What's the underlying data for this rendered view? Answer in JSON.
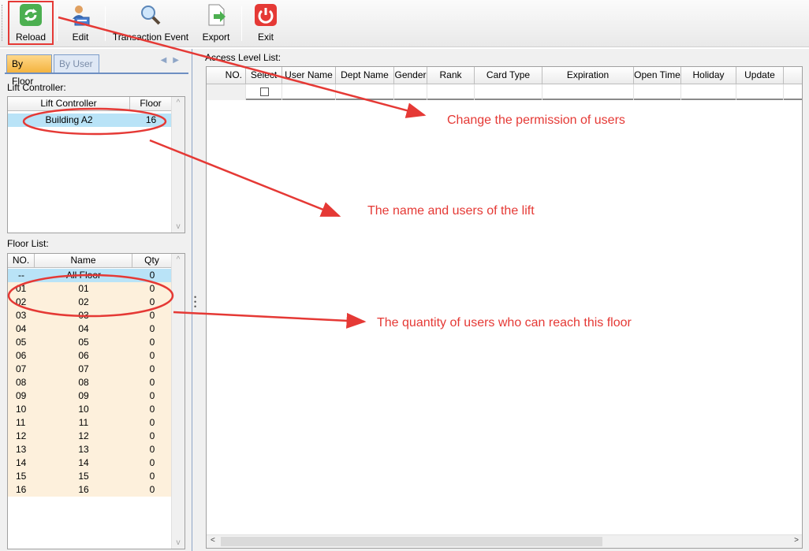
{
  "toolbar": {
    "reload": "Reload",
    "edit": "Edit",
    "transaction_event": "Transaction Event",
    "export": "Export",
    "exit": "Exit"
  },
  "left": {
    "tabs": [
      "By Floor",
      "By User"
    ],
    "lift_controller_label": "Lift Controller:",
    "lift_columns": [
      "Lift Controller",
      "Floor"
    ],
    "lift_rows": [
      {
        "name": "Building A2",
        "floor": "16"
      }
    ],
    "floor_list_label": "Floor List:",
    "floor_columns": [
      "NO.",
      "Name",
      "Qty"
    ],
    "floor_rows": [
      {
        "no": "--",
        "name": "All Floor",
        "qty": "0"
      },
      {
        "no": "01",
        "name": "01",
        "qty": "0"
      },
      {
        "no": "02",
        "name": "02",
        "qty": "0"
      },
      {
        "no": "03",
        "name": "03",
        "qty": "0"
      },
      {
        "no": "04",
        "name": "04",
        "qty": "0"
      },
      {
        "no": "05",
        "name": "05",
        "qty": "0"
      },
      {
        "no": "06",
        "name": "06",
        "qty": "0"
      },
      {
        "no": "07",
        "name": "07",
        "qty": "0"
      },
      {
        "no": "08",
        "name": "08",
        "qty": "0"
      },
      {
        "no": "09",
        "name": "09",
        "qty": "0"
      },
      {
        "no": "10",
        "name": "10",
        "qty": "0"
      },
      {
        "no": "11",
        "name": "11",
        "qty": "0"
      },
      {
        "no": "12",
        "name": "12",
        "qty": "0"
      },
      {
        "no": "13",
        "name": "13",
        "qty": "0"
      },
      {
        "no": "14",
        "name": "14",
        "qty": "0"
      },
      {
        "no": "15",
        "name": "15",
        "qty": "0"
      },
      {
        "no": "16",
        "name": "16",
        "qty": "0"
      }
    ]
  },
  "right": {
    "access_label": "Access Level List:",
    "columns": [
      "NO.",
      "Select",
      "User Name",
      "Dept Name",
      "Gender",
      "Rank",
      "Card Type",
      "Expiration",
      "Open Time",
      "Holiday",
      "Update"
    ]
  },
  "annotations": {
    "permission": "Change the permission of users",
    "lift_name": "The name and users of the lift",
    "floor_qty": "The quantity of users who can reach this floor"
  },
  "colors": {
    "annotation": "#e53935",
    "selected_row": "#b9e3f7",
    "alt_row": "#fdf0dc",
    "active_tab": "#f3b23c"
  }
}
